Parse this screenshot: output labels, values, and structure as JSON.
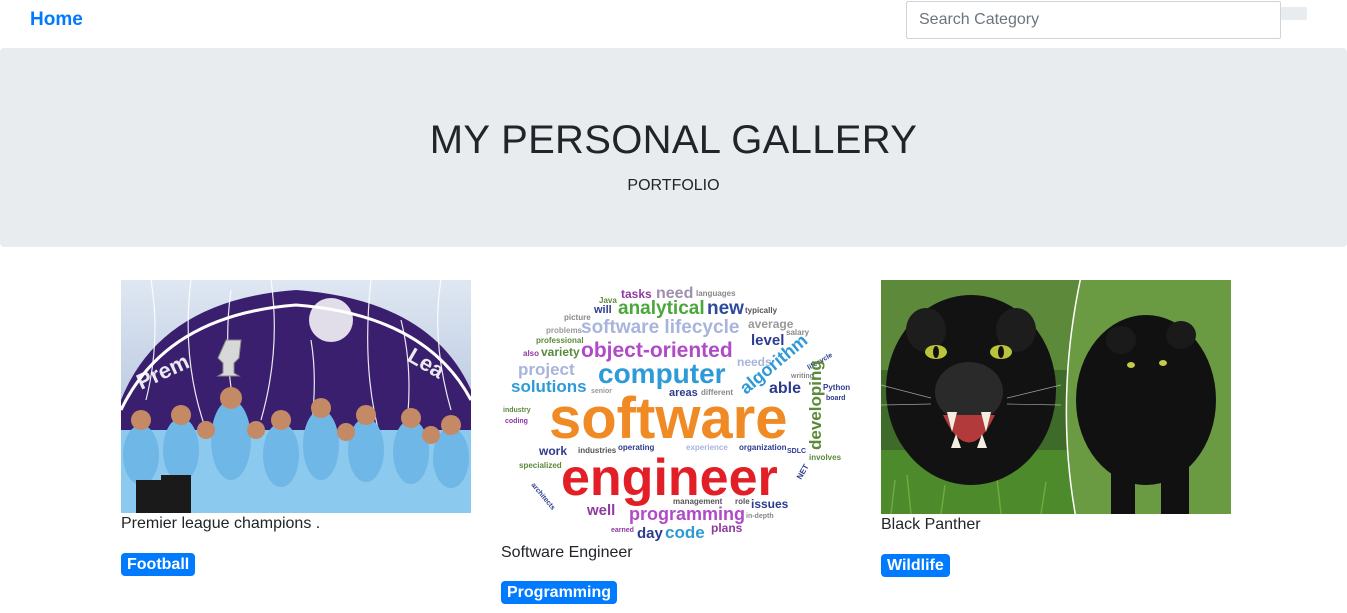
{
  "navbar": {
    "brand": "Home",
    "search_placeholder": "Search Category"
  },
  "jumbotron": {
    "title": "MY PERSONAL GALLERY",
    "subtitle": "PORTFOLIO"
  },
  "cards": [
    {
      "caption": "Premier league champions .",
      "category": "Football"
    },
    {
      "caption": "Software Engineer",
      "category": "Programming"
    },
    {
      "caption": "Black Panther",
      "category": "Wildlife"
    }
  ],
  "wordcloud": {
    "main1": "software",
    "main2": "engineer",
    "words": [
      "tasks",
      "need",
      "languages",
      "Java",
      "will",
      "analytical",
      "new",
      "typically",
      "picture",
      "software lifecycle",
      "average",
      "problems",
      "professional",
      "salary",
      "object-oriented",
      "level",
      "also",
      "variety",
      "project",
      "computer",
      "needs",
      "algorithm",
      "lifecycle",
      "solutions",
      "able",
      "writing",
      "areas",
      "different",
      "senior",
      "Python",
      "board",
      "industry",
      "coding",
      "developing",
      "work",
      "industries",
      "operating",
      "experience",
      "organization",
      "SDLC",
      "specialized",
      "involves",
      "programming",
      "management",
      "role",
      "issues",
      "well",
      "day",
      "code",
      "plans",
      "earned",
      "in-depth",
      "NET",
      "architects"
    ]
  },
  "colors": {
    "brand": "#007bff",
    "jumbotron_bg": "#e9ecef",
    "badge_bg": "#007bff"
  }
}
